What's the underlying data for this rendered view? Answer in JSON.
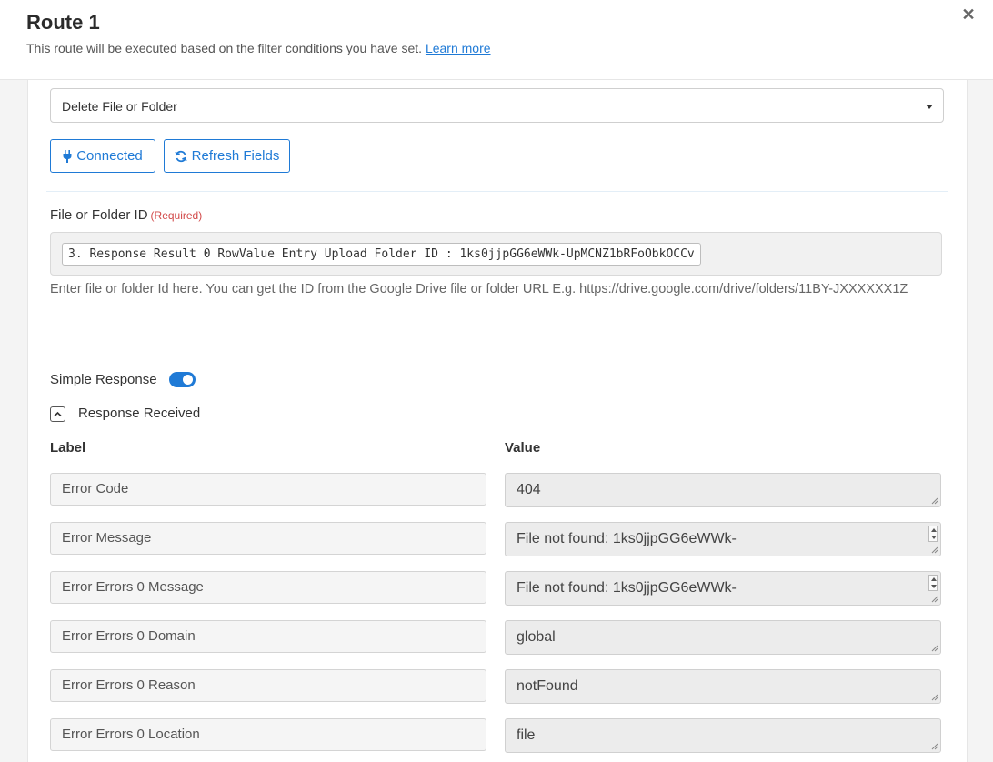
{
  "header": {
    "title": "Route 1",
    "subtitle": "This route will be executed based on the filter conditions you have set.",
    "learn_more": "Learn more",
    "close_icon": "close-icon"
  },
  "action_select": {
    "value": "Delete File or Folder"
  },
  "buttons": {
    "connected": "Connected",
    "refresh": "Refresh Fields"
  },
  "field": {
    "label": "File or Folder ID",
    "required": "(Required)",
    "value": "3. Response Result 0 RowValue Entry Upload Folder ID : 1ks0jjpGG6eWWk-UpMCNZ1bRFoObkOCCv",
    "help": "Enter file or folder Id here. You can get the ID from the Google Drive file or folder URL E.g. https://drive.google.com/drive/folders/11BY-JXXXXXX1Z"
  },
  "simple_response": {
    "label": "Simple Response",
    "enabled": true
  },
  "response": {
    "toggle_label": "Response Received",
    "label_header": "Label",
    "value_header": "Value",
    "rows": [
      {
        "label": "Error Code",
        "value": "404"
      },
      {
        "label": "Error Message",
        "value": "File not found: 1ks0jjpGG6eWWk-"
      },
      {
        "label": "Error Errors 0 Message",
        "value": "File not found: 1ks0jjpGG6eWWk-"
      },
      {
        "label": "Error Errors 0 Domain",
        "value": "global"
      },
      {
        "label": "Error Errors 0 Reason",
        "value": "notFound"
      },
      {
        "label": "Error Errors 0 Location",
        "value": "file"
      }
    ]
  },
  "colors": {
    "accent": "#1f7ad6",
    "required": "#d24a4a"
  }
}
